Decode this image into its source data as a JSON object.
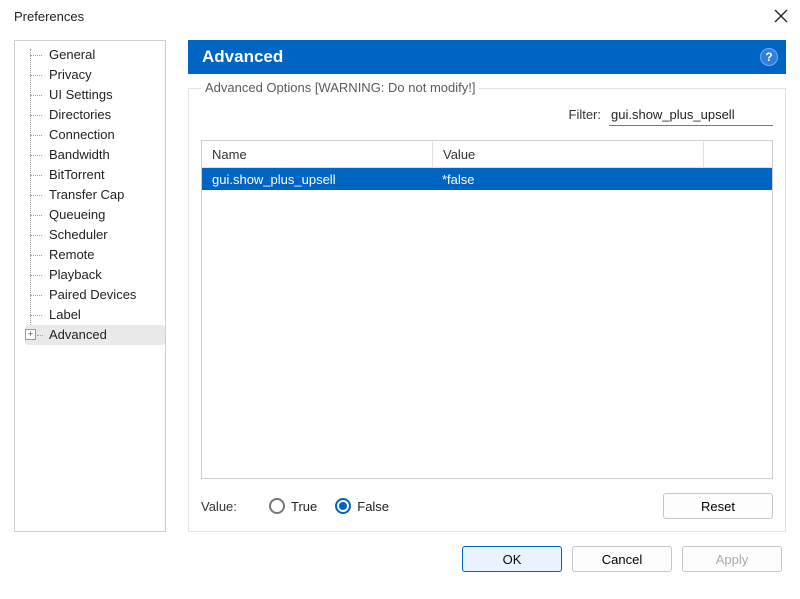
{
  "window": {
    "title": "Preferences"
  },
  "tree": {
    "items": [
      {
        "label": "General"
      },
      {
        "label": "Privacy"
      },
      {
        "label": "UI Settings"
      },
      {
        "label": "Directories"
      },
      {
        "label": "Connection"
      },
      {
        "label": "Bandwidth"
      },
      {
        "label": "BitTorrent"
      },
      {
        "label": "Transfer Cap"
      },
      {
        "label": "Queueing"
      },
      {
        "label": "Scheduler"
      },
      {
        "label": "Remote"
      },
      {
        "label": "Playback"
      },
      {
        "label": "Paired Devices"
      },
      {
        "label": "Label"
      },
      {
        "label": "Advanced",
        "selected": true,
        "hasChildren": true
      }
    ]
  },
  "section": {
    "title": "Advanced",
    "group_legend": "Advanced Options [WARNING: Do not modify!]"
  },
  "filter": {
    "label": "Filter:",
    "value": "gui.show_plus_upsell"
  },
  "table": {
    "headers": {
      "name": "Name",
      "value": "Value"
    },
    "rows": [
      {
        "name": "gui.show_plus_upsell",
        "value": "*false",
        "selected": true
      }
    ]
  },
  "value_row": {
    "label": "Value:",
    "true_label": "True",
    "false_label": "False",
    "selected": "false",
    "reset_label": "Reset"
  },
  "footer": {
    "ok": "OK",
    "cancel": "Cancel",
    "apply": "Apply"
  }
}
